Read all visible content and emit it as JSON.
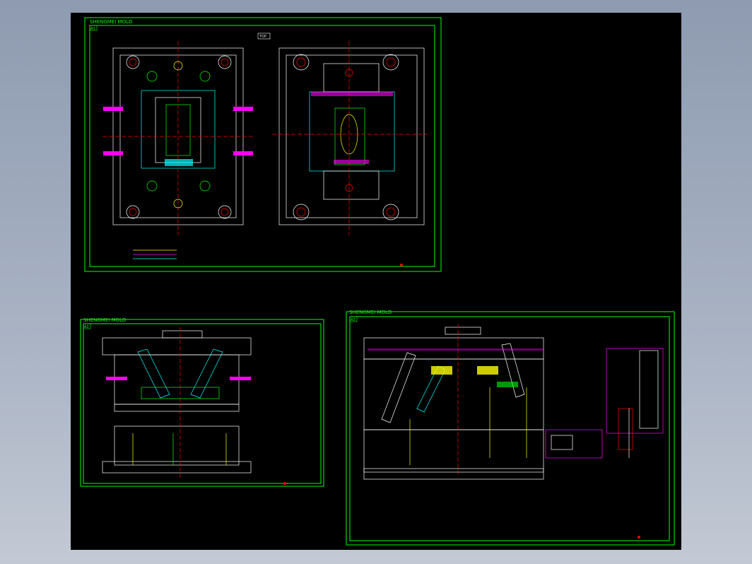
{
  "sheets": [
    {
      "title": "SHENGMEI MOLD",
      "tag": "A3"
    },
    {
      "title": "SHENGMEI MOLD",
      "tag": "A3"
    },
    {
      "title": "SHENGMEI MOLD",
      "tag": "A3"
    }
  ],
  "top_view": {
    "badge": "TOP"
  },
  "colors": {
    "border": "#00ff00",
    "plate": "#ffffff",
    "cyan": "#00ffff",
    "magenta": "#ff00ff",
    "red": "#ff0000",
    "yellow": "#ffff00",
    "background": "#000000",
    "desktop": "#a0aabb"
  }
}
